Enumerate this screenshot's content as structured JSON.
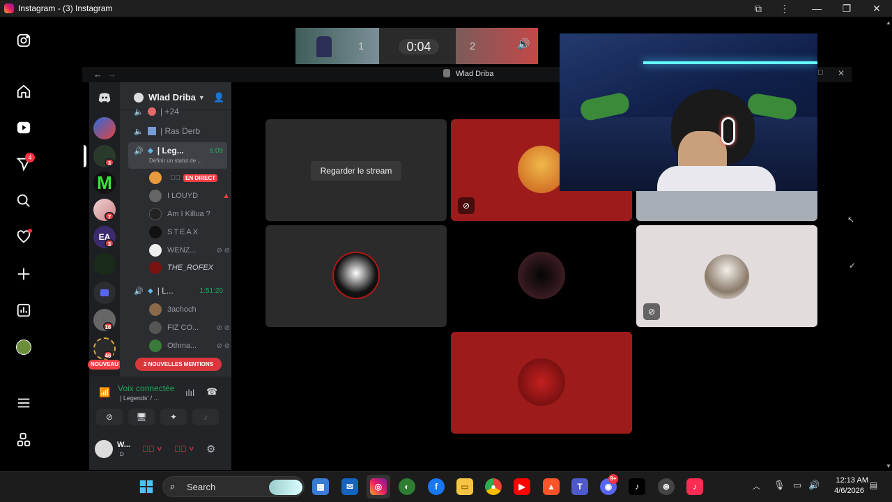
{
  "window": {
    "title": "Instagram - (3) Instagram"
  },
  "ig_sidebar": {
    "icons": [
      "instagram-logo-icon",
      "home-icon",
      "reels-icon",
      "messages-icon",
      "search-icon",
      "notifications-icon",
      "create-icon",
      "dashboard-icon",
      "profile-icon",
      "menu-icon",
      "more-apps-icon"
    ],
    "messages_badge": "4"
  },
  "stream_bar": {
    "team1_score": "1",
    "timer": "0:04",
    "team2_score": "2"
  },
  "discord": {
    "window_title": "Wlad Driba",
    "server_name": "Wlad Driba",
    "server_badges": [
      "3",
      "7",
      "3",
      "16",
      "46"
    ],
    "new_label": "NOUVEAU",
    "mentions_label": "2 NOUVELLES MENTIONS",
    "channels": [
      {
        "name": "| +24"
      },
      {
        "name": "| Ras Derb"
      },
      {
        "name": "| Leg...",
        "time": "6:09",
        "status": "Définir un statut de ..."
      },
      {
        "name": "| L...",
        "time": "1:51:20"
      }
    ],
    "users_a": [
      {
        "name": "",
        "live": "EN DIRECT"
      },
      {
        "name": "I LOUYD"
      },
      {
        "name": "Am I Killua ?"
      },
      {
        "name": "STEAX"
      },
      {
        "name": "WENZ..."
      },
      {
        "name": "THE_ROFEX"
      }
    ],
    "users_b": [
      {
        "name": "3achoch"
      },
      {
        "name": "FIZ CO..."
      },
      {
        "name": "Othma..."
      }
    ],
    "voice": {
      "status": "Voix connectée",
      "channel": "| Legends' / ..."
    },
    "account": {
      "name": "W...",
      "sub": "D"
    },
    "stream_button": "Regarder le stream"
  },
  "taskbar": {
    "search_label": "Search",
    "time": "12:13 AM",
    "date": "4/6/2026",
    "discord_badge": "9+"
  },
  "colors": {
    "discord_red": "#9e1b1b",
    "tile_dark": "#2b2b2b",
    "tile_grey": "#a7aeb5",
    "tile_light": "#e3dcdd",
    "accent_green": "#23a55a"
  }
}
